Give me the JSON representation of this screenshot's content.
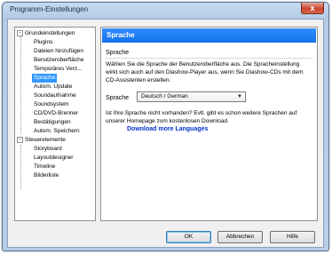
{
  "window": {
    "title": "Programm-Einstellungen",
    "close_glyph": "x"
  },
  "tree": {
    "groups": [
      {
        "label": "Grundeinstellungen",
        "toggle": "-",
        "items": [
          "Plugins",
          "Dateien hinzufügen",
          "Benutzeroberfläche",
          "Temporäres Verz...",
          "Sprache",
          "Autom. Update",
          "Soundaufnahme",
          "Soundsystem",
          "CD/DVD-Brenner",
          "Bestätigungen",
          "Autom. Speichern"
        ]
      },
      {
        "label": "Steuerelemente",
        "toggle": "-",
        "items": [
          "Storyboard",
          "Layoutdesigner",
          "Timeline",
          "Bilderliste"
        ]
      }
    ],
    "selected": "Sprache"
  },
  "panel": {
    "banner": "Sprache",
    "section_title": "Sprache",
    "description": "Wählen Sie die Sprache der Benutzeroberfläche aus. Die Spracheinstellung wirkt sich auch auf den Diashow-Player aus, wenn Sie Diashow-CDs mit dem CD-Assistenten erstellen.",
    "language_label": "Sprache",
    "language_value": "Deutsch / German",
    "missing_text": "Ist Ihre Sprache nicht vorhanden? Evtl. gibt es schon weitere Sprachen auf unserer Homepage zum kostenlosen Download.",
    "download_link": "Download more Languages"
  },
  "buttons": {
    "ok": "OK",
    "cancel": "Abbrechen",
    "help": "Hilfe"
  },
  "colors": {
    "banner": "#1a7cf4",
    "selection": "#3399ff",
    "link": "#0033cc"
  }
}
